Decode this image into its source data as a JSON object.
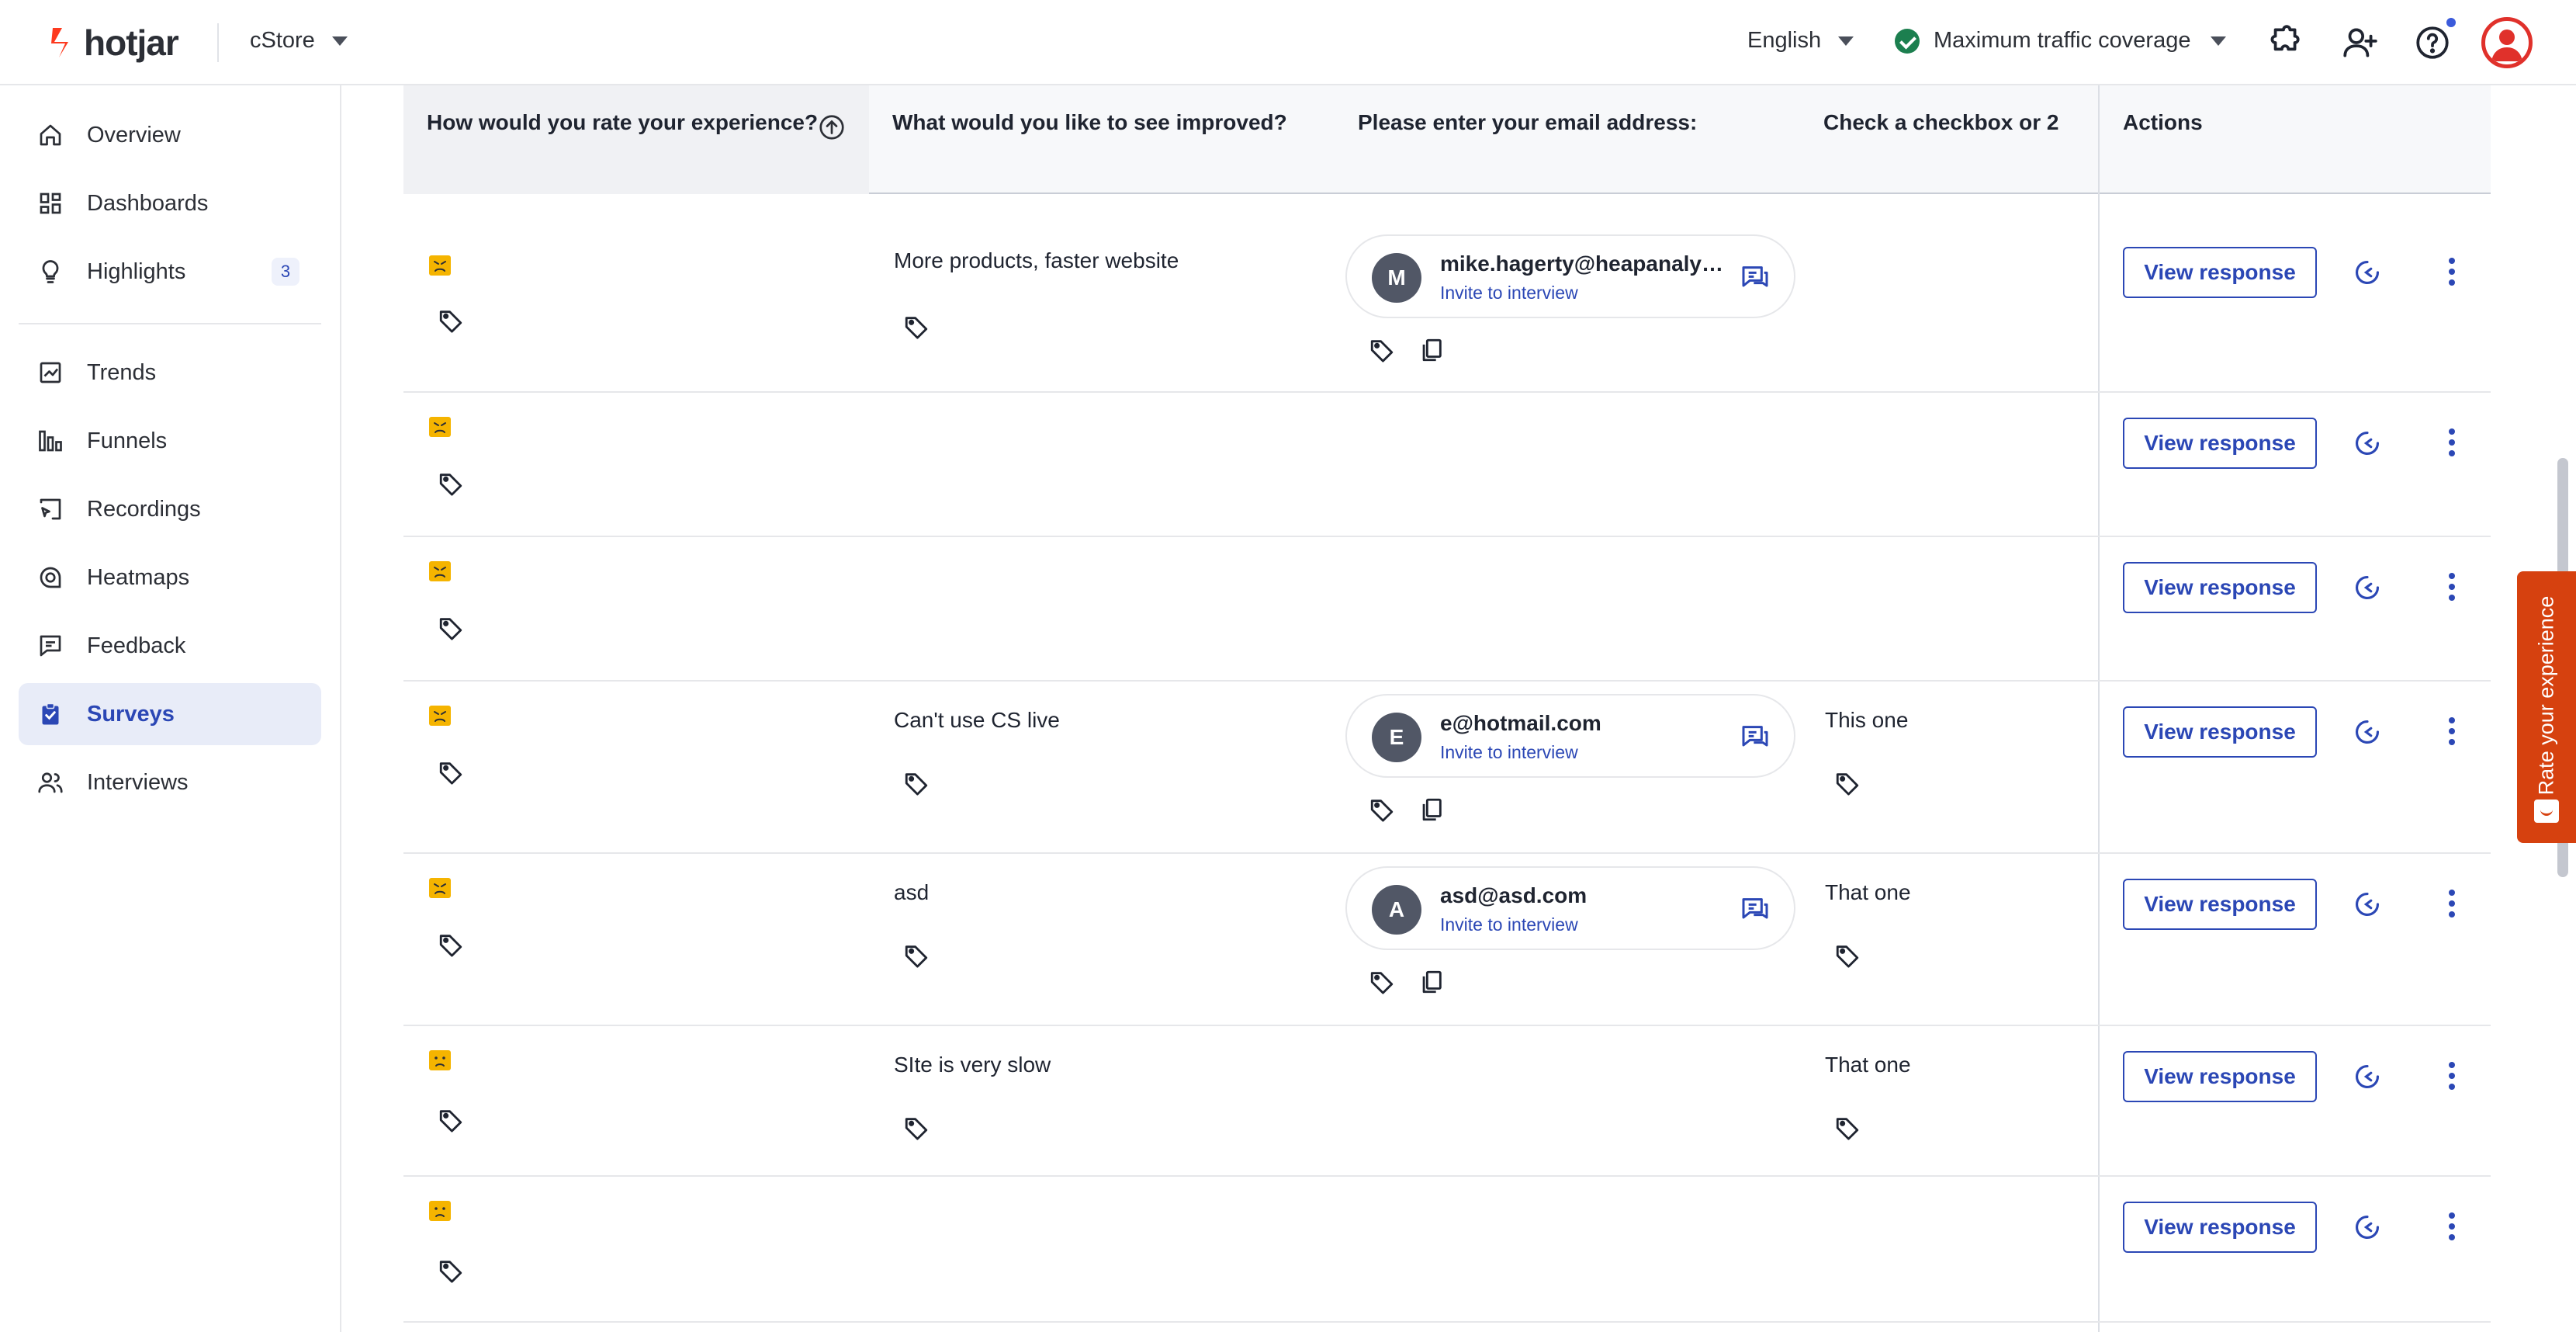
{
  "app": {
    "logo_text": "hotjar",
    "site_name": "cStore",
    "language": "English",
    "traffic_label": "Maximum traffic coverage"
  },
  "colors": {
    "brand": "#fd3a1f",
    "accent": "#2b47b5",
    "rating_emoji": "#f5b400",
    "success": "#1c7f4f",
    "feedback_tab": "#d6410f"
  },
  "sidebar": {
    "items": [
      {
        "label": "Overview",
        "icon": "home-icon"
      },
      {
        "label": "Dashboards",
        "icon": "dashboard-icon"
      },
      {
        "label": "Highlights",
        "icon": "lightbulb-icon",
        "badge": "3"
      },
      {
        "label": "Trends",
        "icon": "trend-chart-icon"
      },
      {
        "label": "Funnels",
        "icon": "funnel-bars-icon"
      },
      {
        "label": "Recordings",
        "icon": "recording-icon"
      },
      {
        "label": "Heatmaps",
        "icon": "heatmap-icon"
      },
      {
        "label": "Feedback",
        "icon": "feedback-icon"
      },
      {
        "label": "Surveys",
        "icon": "survey-clipboard-icon",
        "active": true
      },
      {
        "label": "Interviews",
        "icon": "interviews-people-icon"
      }
    ]
  },
  "table": {
    "columns": [
      "How would you rate your experience?",
      "What would you like to see improved?",
      "Please enter your email address:",
      "Check a checkbox or 2",
      "Actions"
    ],
    "view_label": "View response",
    "invite_label": "Invite to interview",
    "rows": [
      {
        "rating": "very-dissatisfied",
        "improved": "More products, faster website",
        "email": "mike.hagerty@heapanalytic...",
        "initial": "M",
        "checkbox": ""
      },
      {
        "rating": "very-dissatisfied",
        "improved": "",
        "email": "",
        "initial": "",
        "checkbox": ""
      },
      {
        "rating": "very-dissatisfied",
        "improved": "",
        "email": "",
        "initial": "",
        "checkbox": ""
      },
      {
        "rating": "very-dissatisfied",
        "improved": "Can't use CS live",
        "email": "e@hotmail.com",
        "initial": "E",
        "checkbox": "This one"
      },
      {
        "rating": "very-dissatisfied",
        "improved": "asd",
        "email": "asd@asd.com",
        "initial": "A",
        "checkbox": "That one"
      },
      {
        "rating": "dissatisfied",
        "improved": "SIte is very slow",
        "email": "",
        "initial": "",
        "checkbox": "That one"
      },
      {
        "rating": "dissatisfied",
        "improved": "",
        "email": "",
        "initial": "",
        "checkbox": ""
      }
    ]
  },
  "feedback_tab": {
    "label": "Rate your experience"
  }
}
